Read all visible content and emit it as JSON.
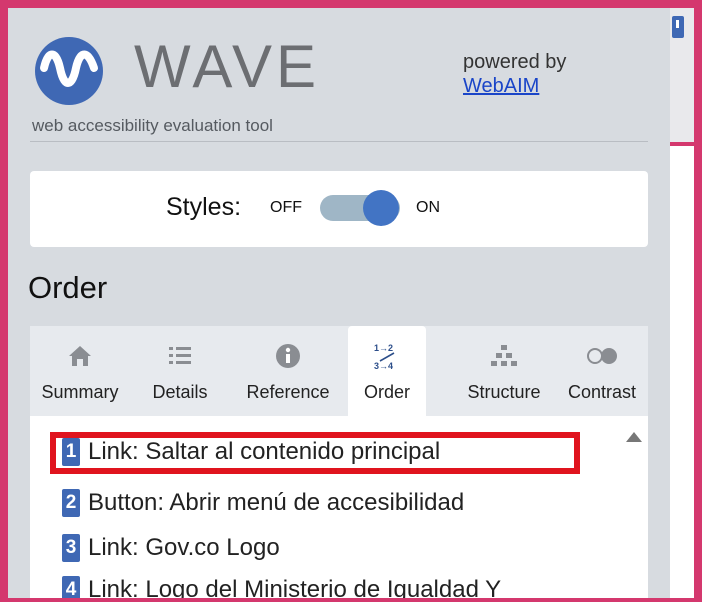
{
  "logo": {
    "word": "WAVE",
    "tagline": "web accessibility evaluation tool"
  },
  "powered": {
    "text": "powered by",
    "link": "WebAIM"
  },
  "styles": {
    "label": "Styles:",
    "off": "OFF",
    "on": "ON",
    "state": "on"
  },
  "section": {
    "title": "Order"
  },
  "tabs": [
    {
      "label": "Summary",
      "icon": "home-icon",
      "active": false
    },
    {
      "label": "Details",
      "icon": "list-icon",
      "active": false
    },
    {
      "label": "Reference",
      "icon": "info-icon",
      "active": false
    },
    {
      "label": "Order",
      "icon": "order-icon",
      "active": true
    },
    {
      "label": "Structure",
      "icon": "structure-icon",
      "active": false
    },
    {
      "label": "Contrast",
      "icon": "contrast-icon",
      "active": false
    }
  ],
  "order_items": [
    {
      "num": "1",
      "text": "Link: Saltar al contenido principal"
    },
    {
      "num": "2",
      "text": "Button: Abrir menú de accesibilidad"
    },
    {
      "num": "3",
      "text": "Link: Gov.co Logo"
    },
    {
      "num": "4",
      "text": "Link: Logo del Ministerio de Igualdad Y"
    }
  ],
  "colors": {
    "frame": "#d4386e",
    "accent": "#3f68b4",
    "highlight": "#e0141e",
    "sidebar": "#d7dbe0"
  }
}
